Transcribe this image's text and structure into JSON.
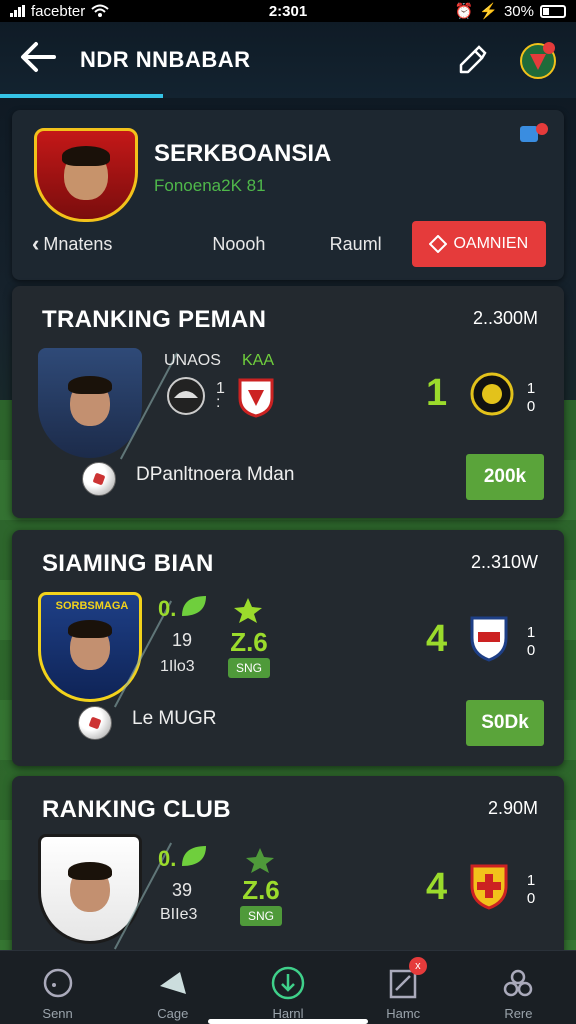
{
  "status_bar": {
    "carrier": "facebter",
    "time": "2:301",
    "battery": "30%"
  },
  "header": {
    "title": "NDR NNBABAR",
    "icons": [
      "back-arrow-icon",
      "edit-icon",
      "avatar-badge-icon"
    ]
  },
  "profile": {
    "name": "SERKBOANSIA",
    "subtitle": "Fonoena2K 81",
    "tabs": {
      "tab1": "Mnatens",
      "tab2": "Noooh",
      "tab3": "Rauml",
      "cta": "OAMNIEN"
    }
  },
  "cards": [
    {
      "title": "TRANKING PEMAN",
      "value": "2..300M",
      "top_label": "UNAOS",
      "top_label_green": "KAA",
      "mini_score": "1\n:",
      "big": "1",
      "score": [
        "1",
        "0"
      ],
      "player": "DPanltnoera Mdan",
      "action": "200k"
    },
    {
      "title": "SIAMING BIAN",
      "value": "2..310W",
      "stat_a": "0.",
      "stat_b": "19",
      "stat_c": "1Ilo3",
      "z": "Z.6",
      "sng": "SNG",
      "big": "4",
      "score": [
        "1",
        "0"
      ],
      "player": "Le MUGR",
      "action": "S0Dk",
      "crest_text": "SORBSMAGA"
    },
    {
      "title": "RANKING CLUB",
      "value": "2.90M",
      "stat_a": "0.",
      "stat_b": "39",
      "stat_c": "BIIe3",
      "z": "Z.6",
      "sng": "SNG",
      "big": "4",
      "score": [
        "1",
        "0"
      ]
    }
  ],
  "bottom_nav": [
    {
      "label": "Senn",
      "icon": "circle-icon"
    },
    {
      "label": "Cage",
      "icon": "pick-icon"
    },
    {
      "label": "Harnl",
      "icon": "home-down-icon"
    },
    {
      "label": "Hamc",
      "icon": "clipboard-icon",
      "badge": "x"
    },
    {
      "label": "Rere",
      "icon": "profile-icon"
    }
  ],
  "colors": {
    "accent_green": "#9bdb2c",
    "button_green": "#5aa43a",
    "cta_red": "#e53b3b",
    "tab_underline": "#35c3e6"
  }
}
